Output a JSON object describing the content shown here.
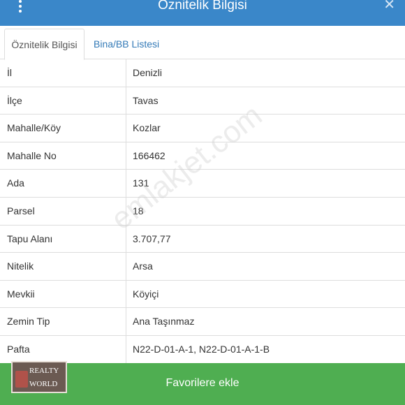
{
  "header": {
    "title": "Öznitelik Bilgisi",
    "close_label": "✕"
  },
  "tabs": [
    {
      "label": "Öznitelik Bilgisi",
      "active": true
    },
    {
      "label": "Bina/BB Listesi",
      "active": false
    }
  ],
  "rows": [
    {
      "key": "İl",
      "value": "Denizli"
    },
    {
      "key": "İlçe",
      "value": "Tavas"
    },
    {
      "key": "Mahalle/Köy",
      "value": "Kozlar"
    },
    {
      "key": "Mahalle No",
      "value": "166462"
    },
    {
      "key": "Ada",
      "value": "131"
    },
    {
      "key": "Parsel",
      "value": "18"
    },
    {
      "key": "Tapu Alanı",
      "value": "3.707,77"
    },
    {
      "key": "Nitelik",
      "value": "Arsa"
    },
    {
      "key": "Mevkii",
      "value": "Köyiçi"
    },
    {
      "key": "Zemin Tip",
      "value": "Ana Taşınmaz"
    },
    {
      "key": "Pafta",
      "value": "N22-D-01-A-1, N22-D-01-A-1-B"
    }
  ],
  "footer": {
    "favorite_label": "Favorilere ekle"
  },
  "watermark": "emlakjet.com",
  "logo": {
    "line1": "REALTY",
    "line2": "WORLD"
  },
  "colors": {
    "header_bg": "#3a87c9",
    "footer_bg": "#4fae51",
    "link": "#337ab7"
  }
}
